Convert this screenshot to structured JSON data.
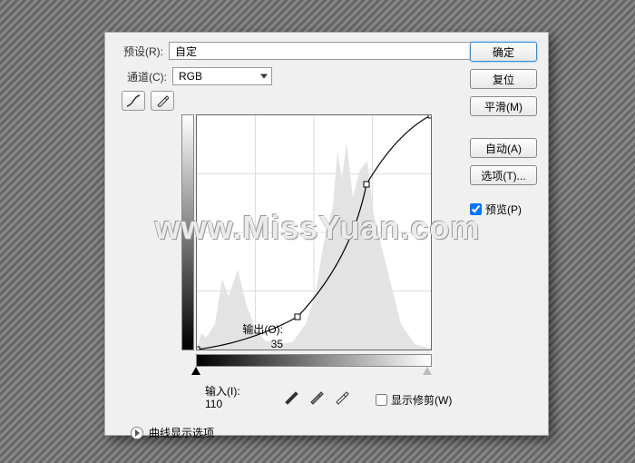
{
  "preset": {
    "label": "预设(R):",
    "value": "自定"
  },
  "channel": {
    "label": "通道(C):",
    "value": "RGB"
  },
  "buttons": {
    "ok": "确定",
    "cancel": "复位",
    "smooth": "平滑(M)",
    "auto": "自动(A)",
    "options": "选项(T)..."
  },
  "preview": {
    "label": "预览(P)",
    "checked": true
  },
  "output": {
    "label": "输出(O):",
    "value": "35"
  },
  "input": {
    "label": "输入(I):",
    "value": "110"
  },
  "show_clip": {
    "label": "显示修剪(W)",
    "checked": false
  },
  "curve_options": "曲线显示选项",
  "watermark": "www.MissYuan.com",
  "chart_data": {
    "type": "line",
    "title": "Curves",
    "xlabel": "Input",
    "ylabel": "Output",
    "xlim": [
      0,
      255
    ],
    "ylim": [
      0,
      255
    ],
    "points": [
      {
        "x": 0,
        "y": 0
      },
      {
        "x": 110,
        "y": 35
      },
      {
        "x": 185,
        "y": 180
      },
      {
        "x": 255,
        "y": 255
      }
    ],
    "histogram_peaks": "broad distribution with major peak around x≈175-200 and secondary mass near x≈30-60"
  }
}
